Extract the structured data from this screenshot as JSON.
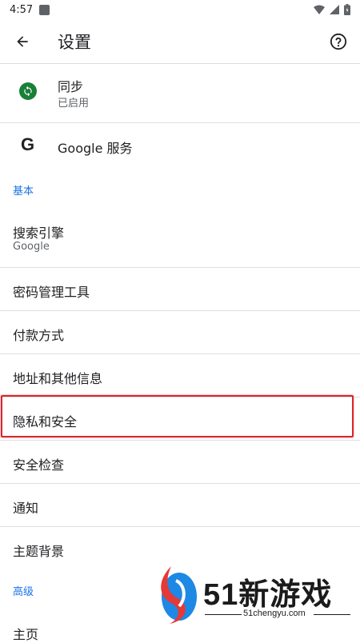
{
  "status_bar": {
    "time": "4:57"
  },
  "app_bar": {
    "title": "设置",
    "back_icon": "arrow-back-icon",
    "help_icon": "help-circle-icon"
  },
  "sync": {
    "label": "同步",
    "status": "已启用"
  },
  "google_services": {
    "label": "Google 服务"
  },
  "sections": {
    "basic": "基本",
    "advanced": "高级"
  },
  "items": {
    "search_engine": {
      "label": "搜索引擎",
      "value": "Google"
    },
    "passwords": "密码管理工具",
    "payments": "付款方式",
    "addresses": "地址和其他信息",
    "privacy": "隐私和安全",
    "safety_check": "安全检查",
    "notifications": "通知",
    "theme": "主题背景",
    "homepage": "主页"
  },
  "watermark": {
    "brand": "51新游戏",
    "url": "51chengyu.com"
  },
  "colors": {
    "accent": "#1a73e8",
    "sync_green": "#188038",
    "highlight_red": "#d9262b"
  }
}
